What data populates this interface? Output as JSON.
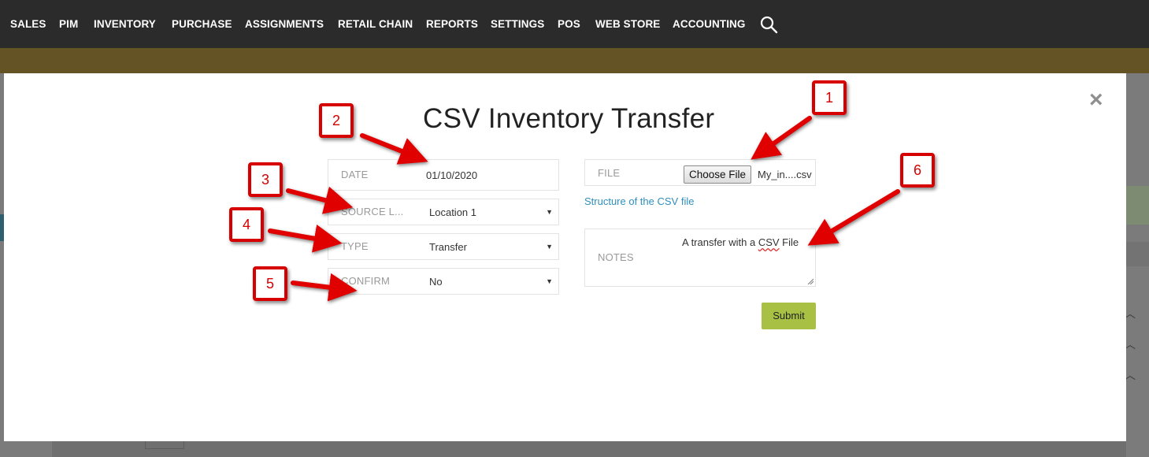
{
  "nav": {
    "items": [
      {
        "label": "SALES"
      },
      {
        "label": "PIM"
      },
      {
        "label": "INVENTORY"
      },
      {
        "label": "PURCHASE"
      },
      {
        "label": "ASSIGNMENTS"
      },
      {
        "label": "RETAIL CHAIN"
      },
      {
        "label": "REPORTS"
      },
      {
        "label": "SETTINGS"
      },
      {
        "label": "POS"
      },
      {
        "label": "WEB STORE"
      },
      {
        "label": "ACCOUNTING"
      }
    ],
    "search_icon": "search-icon"
  },
  "modal": {
    "title": "CSV Inventory Transfer",
    "close_glyph": "×",
    "date": {
      "label": "DATE",
      "value": "01/10/2020"
    },
    "source_location": {
      "label": "SOURCE L...",
      "value": "Location 1"
    },
    "type": {
      "label": "TYPE",
      "value": "Transfer"
    },
    "confirm": {
      "label": "CONFIRM",
      "value": "No"
    },
    "file": {
      "label": "FILE",
      "button_label": "Choose File",
      "file_name": "My_in....csv"
    },
    "csv_structure_link": "Structure of the CSV file",
    "notes": {
      "label": "NOTES",
      "value_before": "A transfer with a ",
      "value_misspelled": "CSV",
      "value_after": " File"
    },
    "submit_label": "Submit",
    "caret": "▼"
  },
  "callouts": [
    "1",
    "2",
    "3",
    "4",
    "5",
    "6"
  ],
  "colors": {
    "nav_bg": "#2b2b2b",
    "accent_bar": "#645324",
    "submit": "#a8c144",
    "link": "#2f8fbd",
    "callout_red": "#d60000"
  }
}
